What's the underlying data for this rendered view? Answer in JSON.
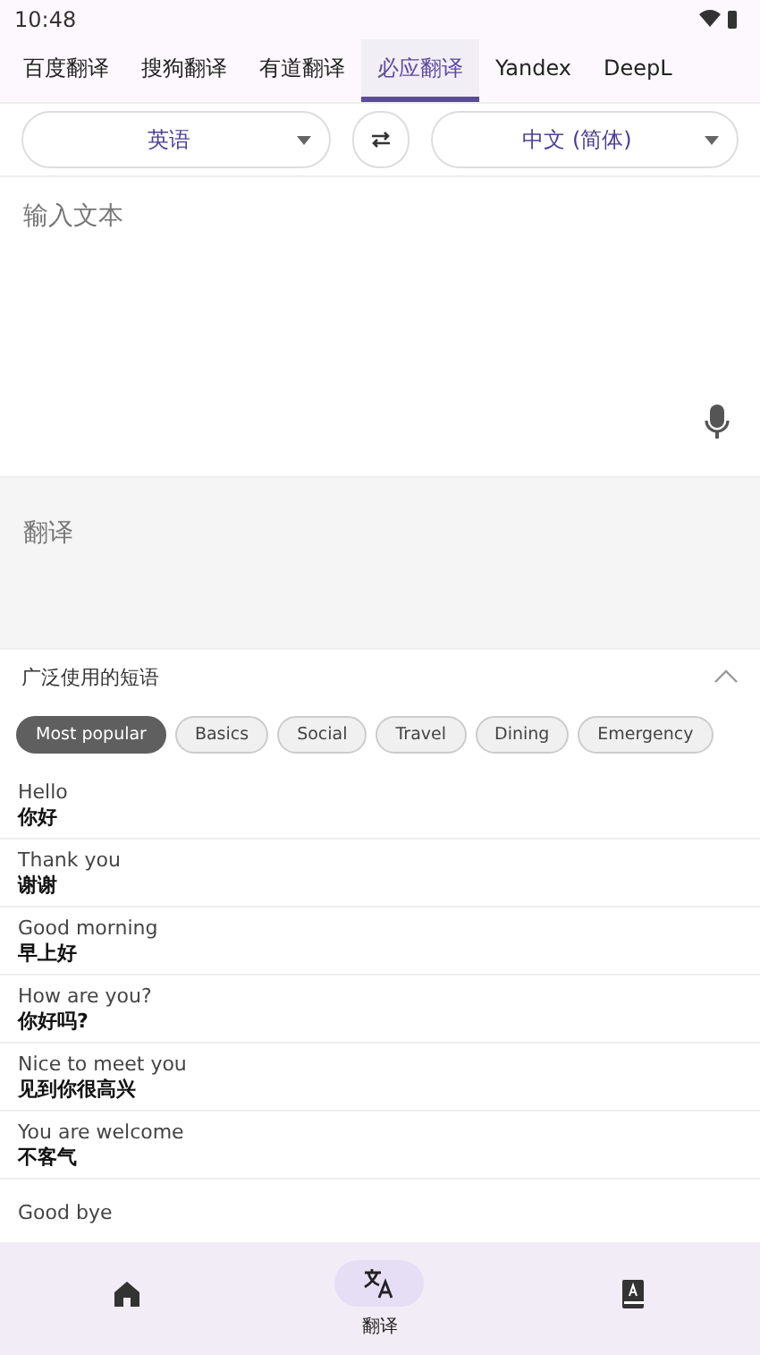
{
  "status_bar": {
    "time": "10:48"
  },
  "tabs": [
    {
      "label": "百度翻译",
      "selected": false
    },
    {
      "label": "搜狗翻译",
      "selected": false
    },
    {
      "label": "有道翻译",
      "selected": false
    },
    {
      "label": "必应翻译",
      "selected": true
    },
    {
      "label": "Yandex",
      "selected": false
    },
    {
      "label": "DeepL",
      "selected": false
    }
  ],
  "languages": {
    "source": "英语",
    "target": "中文 (简体)"
  },
  "input": {
    "placeholder": "输入文本"
  },
  "output": {
    "placeholder": "翻译"
  },
  "phrases": {
    "title": "广泛使用的短语",
    "expanded": true,
    "chips": [
      {
        "label": "Most popular",
        "selected": true
      },
      {
        "label": "Basics",
        "selected": false
      },
      {
        "label": "Social",
        "selected": false
      },
      {
        "label": "Travel",
        "selected": false
      },
      {
        "label": "Dining",
        "selected": false
      },
      {
        "label": "Emergency",
        "selected": false
      }
    ],
    "items": [
      {
        "source": "Hello",
        "target": "你好"
      },
      {
        "source": "Thank you",
        "target": "谢谢"
      },
      {
        "source": "Good morning",
        "target": "早上好"
      },
      {
        "source": "How are you?",
        "target": "你好吗?"
      },
      {
        "source": "Nice to meet you",
        "target": "见到你很高兴"
      },
      {
        "source": "You are welcome",
        "target": "不客气"
      },
      {
        "source": "Good bye"
      }
    ]
  },
  "bottom_nav": [
    {
      "kind": "home",
      "selected": false
    },
    {
      "kind": "translate",
      "label": "翻译",
      "selected": true
    },
    {
      "kind": "dictionary",
      "selected": false
    }
  ]
}
